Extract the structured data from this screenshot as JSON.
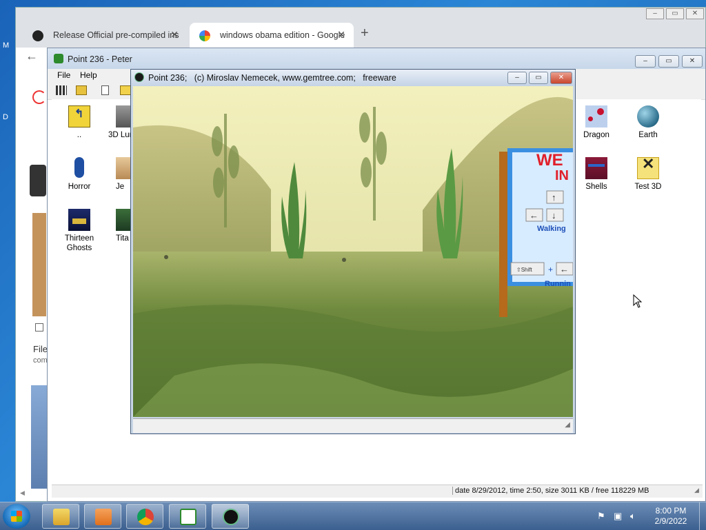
{
  "browser": {
    "tabs": [
      {
        "label": "Release Official pre-compiled ins"
      },
      {
        "label": "windows obama edition - Google"
      }
    ],
    "new_tab": "+",
    "back": "←",
    "partial_text": {
      "file": "File",
      "com": "com"
    }
  },
  "desktop": {
    "edge_letters": [
      "M",
      "D"
    ]
  },
  "file_manager": {
    "title": "Point 236 - Peter",
    "menu": [
      "File",
      "Help"
    ],
    "items": [
      {
        "label": "..",
        "icon": "folder-up-icon"
      },
      {
        "label": "3D Lun",
        "icon": "file-thumb-icon"
      },
      {
        "label": "Dragon",
        "icon": "dragon-icon"
      },
      {
        "label": "Earth",
        "icon": "earth-icon"
      },
      {
        "label": "Horror",
        "icon": "horror-icon"
      },
      {
        "label": "Je",
        "icon": "file-thumb-icon"
      },
      {
        "label": "Shells",
        "icon": "shells-icon"
      },
      {
        "label": "Test 3D",
        "icon": "test3d-icon"
      },
      {
        "label": "Thirteen Ghosts",
        "icon": "ghosts-icon"
      },
      {
        "label": "Tita",
        "icon": "file-thumb-icon"
      }
    ],
    "status": "date 8/29/2012, time 2:50, size 3011 KB / free 118229 MB"
  },
  "game": {
    "title": "Point 236;   (c) Miroslav Nemecek, www.gemtree.com;   freeware",
    "sign": {
      "heading": "WE\nIN",
      "walking": "Walking",
      "running": "Runnin",
      "shift": "Shift"
    }
  },
  "window_controls": {
    "minimize": "–",
    "maximize": "▭",
    "close": "✕"
  },
  "taskbar": {
    "time": "8:00 PM",
    "date": "2/9/2022",
    "buttons": [
      "explorer",
      "media-player",
      "chrome",
      "peter",
      "point236"
    ]
  },
  "colors": {
    "game_sign": "#3b8fe0",
    "sign_text": "#e0202a",
    "taskbar": "#4d6f9d"
  }
}
